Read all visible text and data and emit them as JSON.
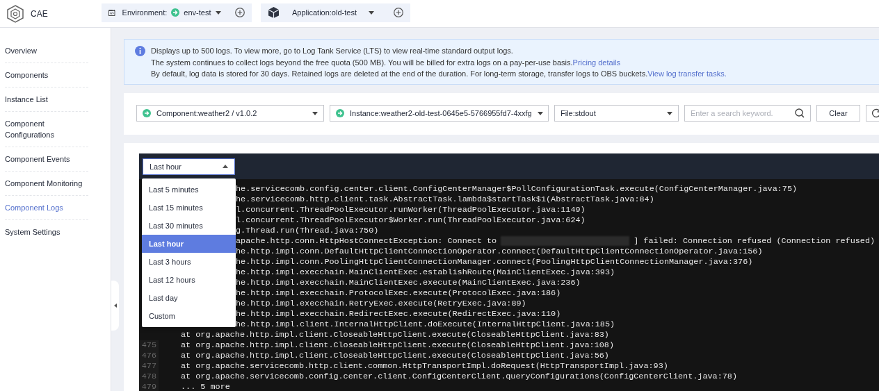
{
  "header": {
    "product": "CAE",
    "environment": {
      "label": "Environment:",
      "value": "env-test"
    },
    "application": {
      "label": "Application:old-test"
    }
  },
  "sidebar": {
    "items": [
      {
        "label": "Overview",
        "selected": false
      },
      {
        "label": "Components",
        "selected": false
      },
      {
        "label": "Instance List",
        "selected": false
      },
      {
        "label": "Component Configurations",
        "selected": false
      },
      {
        "label": "Component Events",
        "selected": false
      },
      {
        "label": "Component Monitoring",
        "selected": false
      },
      {
        "label": "Component Logs",
        "selected": true
      },
      {
        "label": "System Settings",
        "selected": false
      }
    ]
  },
  "notice": {
    "lines": [
      {
        "text": "Displays up to 500 logs. To view more, go to Log Tank Service (LTS) to view real-time standard output logs."
      },
      {
        "text": "The system continues to collect logs beyond the free quota (500 MB). You will be billed for extra logs on a pay-per-use basis.",
        "link": "Pricing details"
      },
      {
        "text": "By default, log data is stored for 30 days. Retained logs are deleted at the end of the duration. For long-term storage, transfer logs to OBS buckets.",
        "link": "View log transfer tasks."
      }
    ]
  },
  "filters": {
    "component": "Component:weather2 / v1.0.2",
    "instance": "Instance:weather2-old-test-0645e5-5766955fd7-4xxfg",
    "file": "File:stdout",
    "search": {
      "placeholder": "Enter a search keyword."
    },
    "clear": "Clear"
  },
  "log_viewer": {
    "time_range": {
      "value": "Last hour",
      "expanded": true,
      "options": [
        {
          "label": "Last 5 minutes",
          "selected": false
        },
        {
          "label": "Last 15 minutes",
          "selected": false
        },
        {
          "label": "Last 30 minutes",
          "selected": false
        },
        {
          "label": "Last hour",
          "selected": true
        },
        {
          "label": "Last 3 hours",
          "selected": false
        },
        {
          "label": "Last 12 hours",
          "selected": false
        },
        {
          "label": "Last day",
          "selected": false
        },
        {
          "label": "Custom",
          "selected": false
        }
      ]
    },
    "lines": [
      {
        "kind": "covered",
        "text": "he.servicecomb.config.center.client.ConfigCenterManager$PollConfigurationTask.execute(ConfigCenterManager.java:75)"
      },
      {
        "kind": "covered",
        "text": "he.servicecomb.http.client.task.AbstractTask.lambda$startTask$1(AbstractTask.java:84)"
      },
      {
        "kind": "covered",
        "text": "l.concurrent.ThreadPoolExecutor.runWorker(ThreadPoolExecutor.java:1149)"
      },
      {
        "kind": "covered",
        "text": "l.concurrent.ThreadPoolExecutor$Worker.run(ThreadPoolExecutor.java:624)"
      },
      {
        "kind": "covered",
        "text": "g.Thread.run(Thread.java:750)"
      },
      {
        "kind": "redacted",
        "text": "apache.http.conn.HttpHostConnectException: Connect to",
        "text_after": "] failed: Connection refused (Connection refused)"
      },
      {
        "kind": "covered",
        "text": "he.http.impl.conn.DefaultHttpClientConnectionOperator.connect(DefaultHttpClientConnectionOperator.java:156)"
      },
      {
        "kind": "covered",
        "text": "he.http.impl.conn.PoolingHttpClientConnectionManager.connect(PoolingHttpClientConnectionManager.java:376)"
      },
      {
        "kind": "covered",
        "text": "he.http.impl.execchain.MainClientExec.establishRoute(MainClientExec.java:393)"
      },
      {
        "kind": "covered",
        "text": "he.http.impl.execchain.MainClientExec.execute(MainClientExec.java:236)"
      },
      {
        "kind": "covered",
        "text": "he.http.impl.execchain.ProtocolExec.execute(ProtocolExec.java:186)"
      },
      {
        "kind": "covered",
        "text": "he.http.impl.execchain.RetryExec.execute(RetryExec.java:89)"
      },
      {
        "kind": "covered",
        "text": "he.http.impl.execchain.RedirectExec.execute(RedirectExec.java:110)"
      },
      {
        "kind": "covered",
        "text": "he.http.impl.client.InternalHttpClient.doExecute(InternalHttpClient.java:185)"
      },
      {
        "kind": "full",
        "text": "at org.apache.http.impl.client.CloseableHttpClient.execute(CloseableHttpClient.java:83)"
      },
      {
        "kind": "full",
        "number": "475",
        "text": "at org.apache.http.impl.client.CloseableHttpClient.execute(CloseableHttpClient.java:108)"
      },
      {
        "kind": "full",
        "number": "476",
        "text": "at org.apache.http.impl.client.CloseableHttpClient.execute(CloseableHttpClient.java:56)"
      },
      {
        "kind": "full",
        "number": "477",
        "text": "at org.apache.servicecomb.http.client.common.HttpTransportImpl.doRequest(HttpTransportImpl.java:93)"
      },
      {
        "kind": "full",
        "number": "478",
        "text": "at org.apache.servicecomb.config.center.client.ConfigCenterClient.queryConfigurations(ConfigCenterClient.java:78)"
      },
      {
        "kind": "full",
        "number": "479",
        "text": "... 5 more"
      }
    ]
  }
}
